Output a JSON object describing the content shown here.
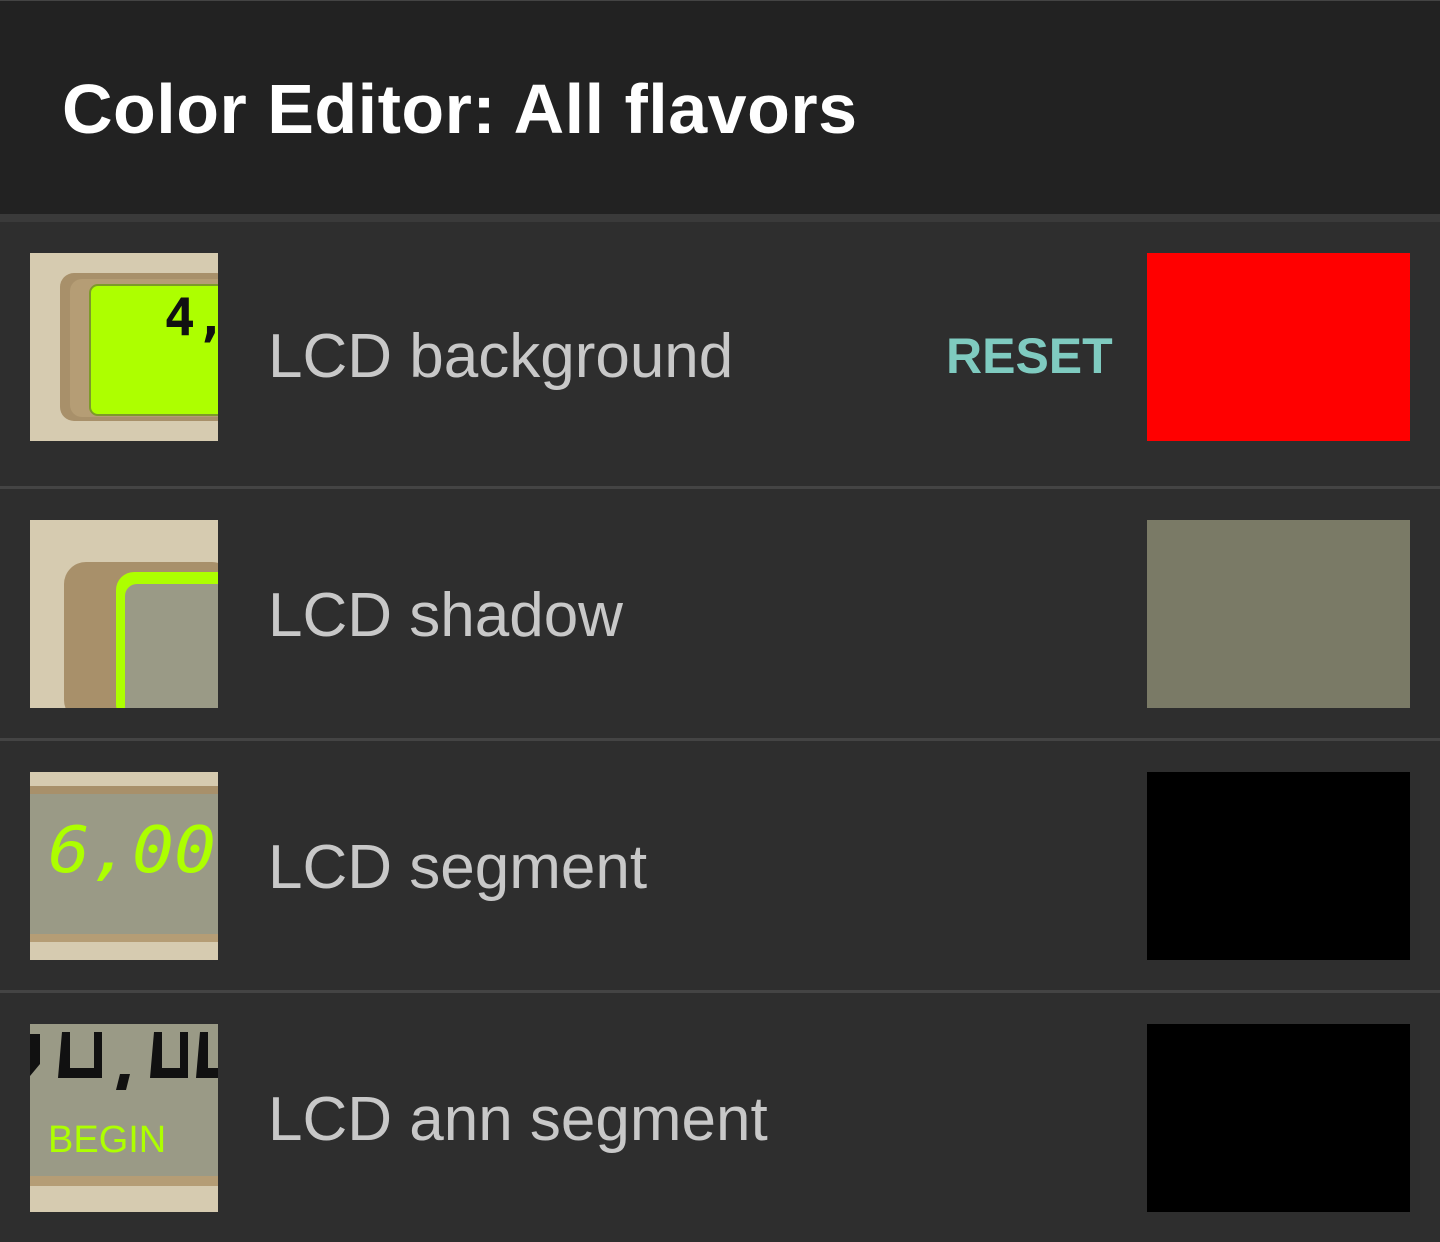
{
  "header": {
    "title": "Color Editor: All flavors"
  },
  "rows": [
    {
      "label": "LCD background",
      "reset_label": "RESET",
      "color": "#ff0000",
      "thumb_text": "4,"
    },
    {
      "label": "LCD shadow",
      "color": "#7a7a66"
    },
    {
      "label": "LCD segment",
      "color": "#000000",
      "thumb_text": "6,00"
    },
    {
      "label": "LCD ann segment",
      "color": "#000000",
      "thumb_text": "BEGIN"
    }
  ],
  "colors": {
    "header_bg": "#222222",
    "list_bg": "#2e2e2e",
    "reset_accent": "#7fcbc0",
    "lcd_green": "#adff00",
    "bezel_beige": "#d6cbb0",
    "bezel_brown": "#a8906a"
  }
}
